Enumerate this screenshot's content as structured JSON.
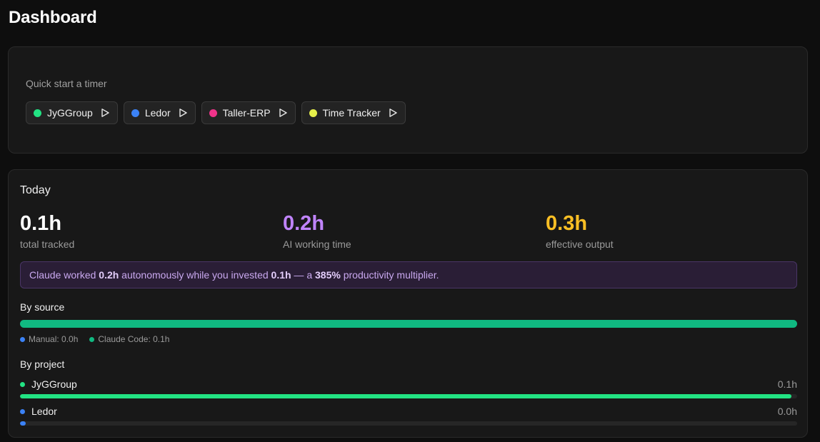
{
  "page": {
    "title": "Dashboard"
  },
  "quick_start": {
    "label": "Quick start a timer",
    "projects": [
      {
        "name": "JyGGroup",
        "color": "#22e383"
      },
      {
        "name": "Ledor",
        "color": "#3b82f6"
      },
      {
        "name": "Taller-ERP",
        "color": "#f0338a"
      },
      {
        "name": "Time Tracker",
        "color": "#e6f04a"
      }
    ]
  },
  "today": {
    "title": "Today",
    "stats": [
      {
        "value": "0.1h",
        "label": "total tracked",
        "color": "#ffffff"
      },
      {
        "value": "0.2h",
        "label": "AI working time",
        "color": "#c084fc"
      },
      {
        "value": "0.3h",
        "label": "effective output",
        "color": "#fbbf24"
      }
    ],
    "banner": {
      "t1": "Claude worked ",
      "ai_hours": "0.2h",
      "t2": " autonomously while you invested ",
      "manual_hours": "0.1h",
      "t3": " — a ",
      "multiplier": "385%",
      "t4": " productivity multiplier."
    },
    "by_source": {
      "title": "By source",
      "segments": [
        {
          "label": "Manual: 0.0h",
          "color": "#3b82f6",
          "fraction": 0.0
        },
        {
          "label": "Claude Code: 0.1h",
          "color": "#10b981",
          "fraction": 1.0
        }
      ]
    },
    "by_project": {
      "title": "By project",
      "items": [
        {
          "name": "JyGGroup",
          "hours": "0.1h",
          "color": "#22e383",
          "fraction": 0.993
        },
        {
          "name": "Ledor",
          "hours": "0.0h",
          "color": "#3b82f6",
          "fraction": 0.007
        }
      ]
    }
  }
}
